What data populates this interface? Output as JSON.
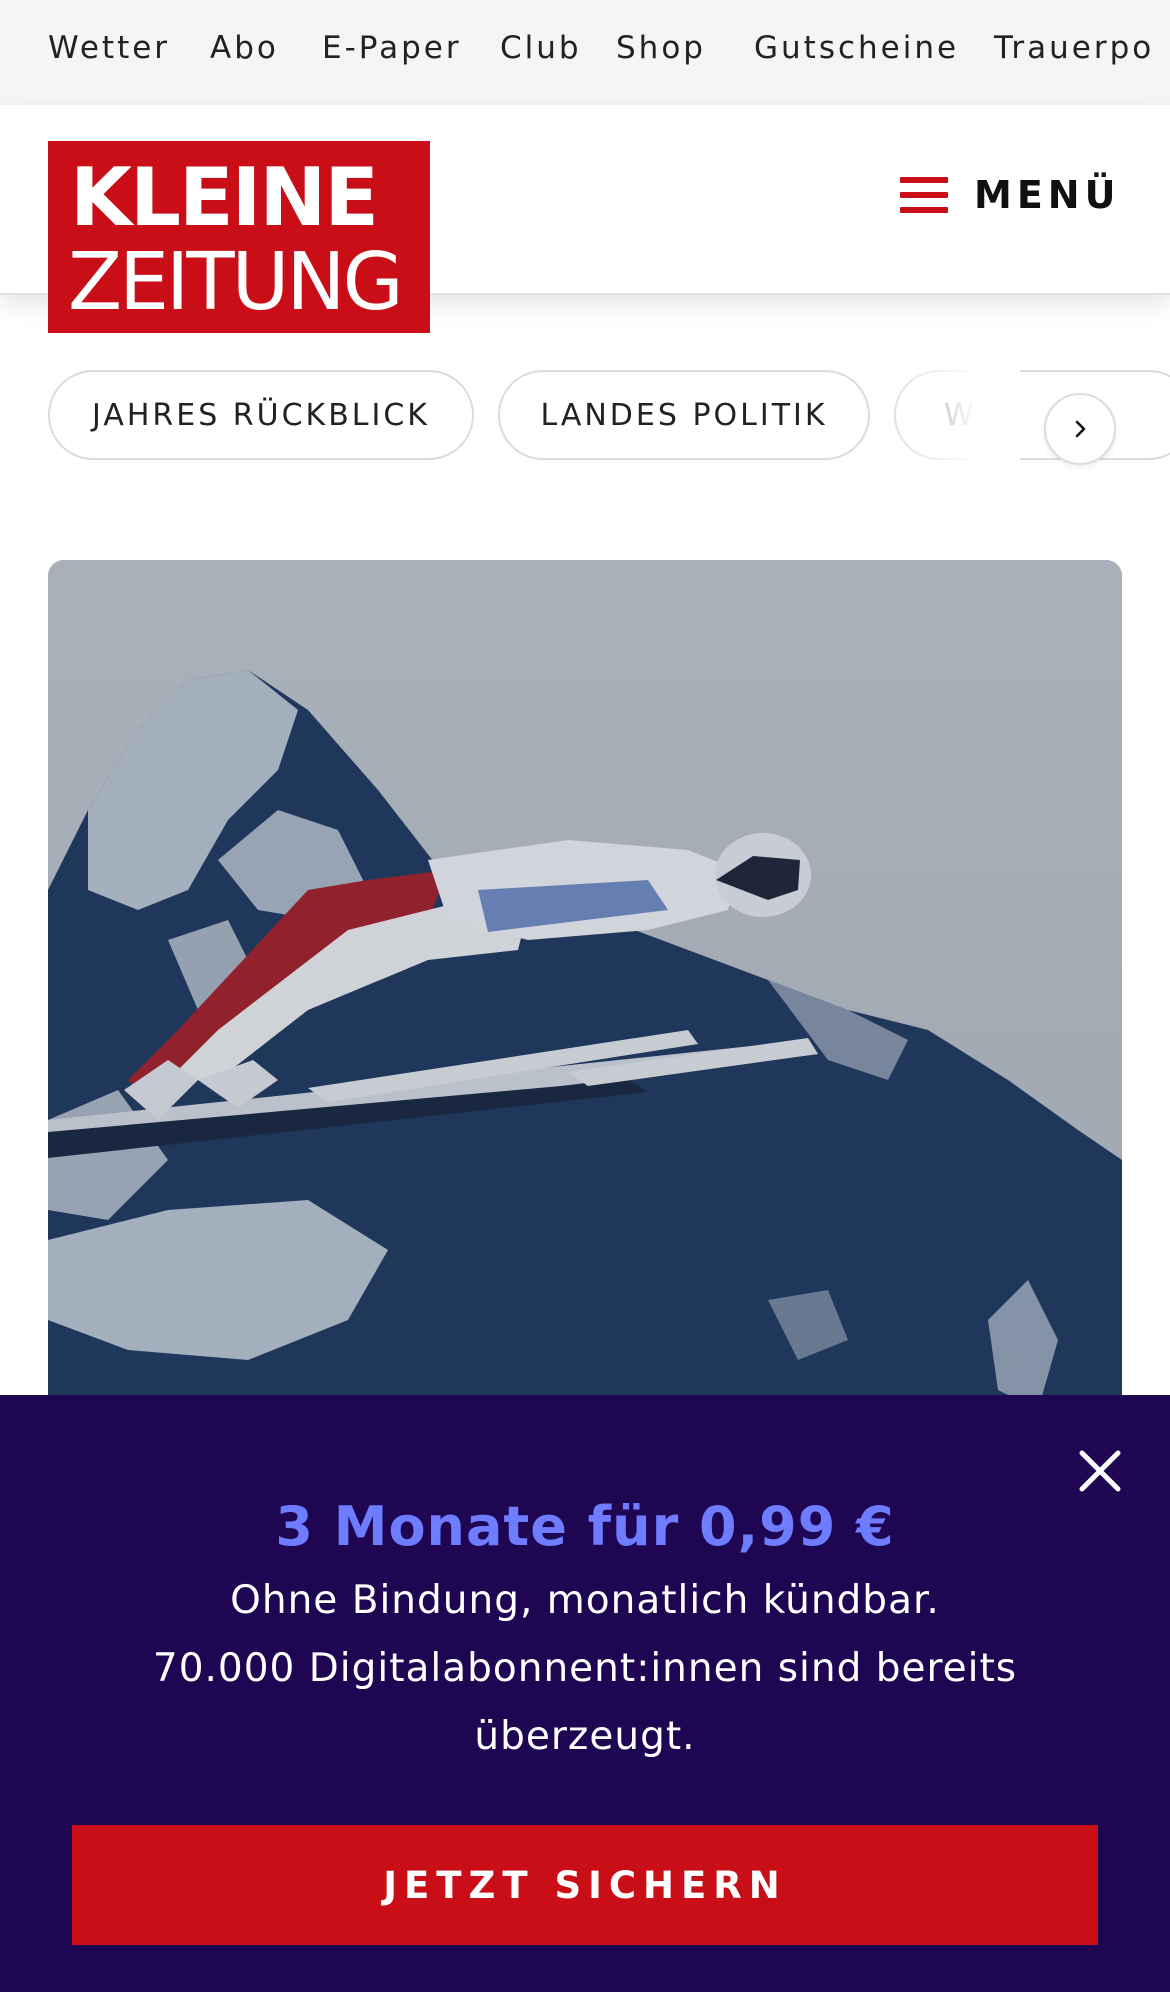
{
  "topnav": {
    "links": [
      "Wetter",
      "Abo",
      "E-Paper",
      "Club",
      "Shop",
      "Gutscheine",
      "Trauerpo"
    ]
  },
  "header": {
    "logo_line1": "KLEINE",
    "logo_line2": "ZEITUNG",
    "menu_label": "MENÜ",
    "brand_color": "#c90e18"
  },
  "categories": {
    "items": [
      "JAHRES RÜCKBLICK",
      "LANDES POLITIK",
      "WE"
    ],
    "next_icon": "chevron-right-icon"
  },
  "hero": {
    "image": "ski-jumper-icon"
  },
  "promo": {
    "title": "3 Monate für 0,99 €",
    "line1": "Ohne Bindung, monatlich kündbar.",
    "line2": "70.000 Digitalabonnent:innen sind bereits",
    "line3": "überzeugt.",
    "cta_label": "JETZT SICHERN",
    "close_icon": "close-icon",
    "background_color": "#1e0653",
    "title_color": "#6e7dff"
  }
}
